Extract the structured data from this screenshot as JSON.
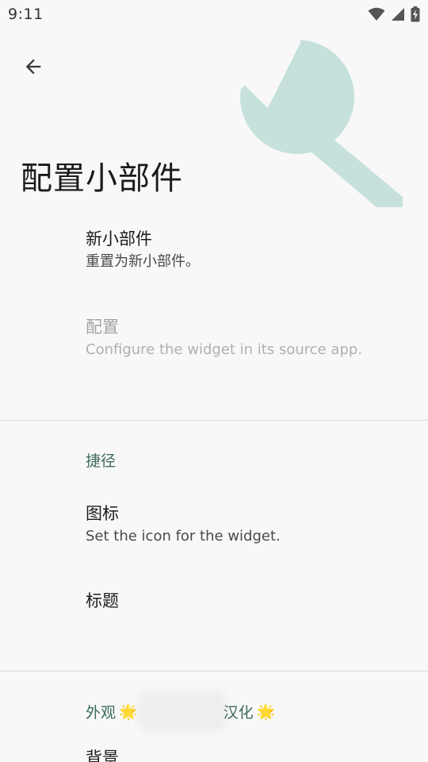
{
  "status_bar": {
    "time": "9:11",
    "icons": [
      "wifi-icon",
      "signal-icon",
      "battery-charging-icon"
    ]
  },
  "colors": {
    "background": "#f8f8f8",
    "accent": "#3d6b5a",
    "hero_art": "#c6e1dc"
  },
  "toolbar": {
    "back_icon": "arrow-left-icon"
  },
  "header": {
    "title": "配置小部件"
  },
  "widget_section": {
    "items": [
      {
        "title": "新小部件",
        "summary": "重置为新小部件。",
        "enabled": true
      },
      {
        "title": "配置",
        "summary": "Configure the widget in its source app.",
        "enabled": false
      }
    ]
  },
  "shortcut_section": {
    "category": "捷径",
    "items": [
      {
        "title": "图标",
        "summary": "Set the icon for the widget."
      },
      {
        "title": "标题"
      }
    ]
  },
  "appearance_section": {
    "category_prefix": "外观",
    "category_suffix": "汉化",
    "star_icon": "🌟",
    "items": [
      {
        "title": "背景"
      }
    ]
  }
}
